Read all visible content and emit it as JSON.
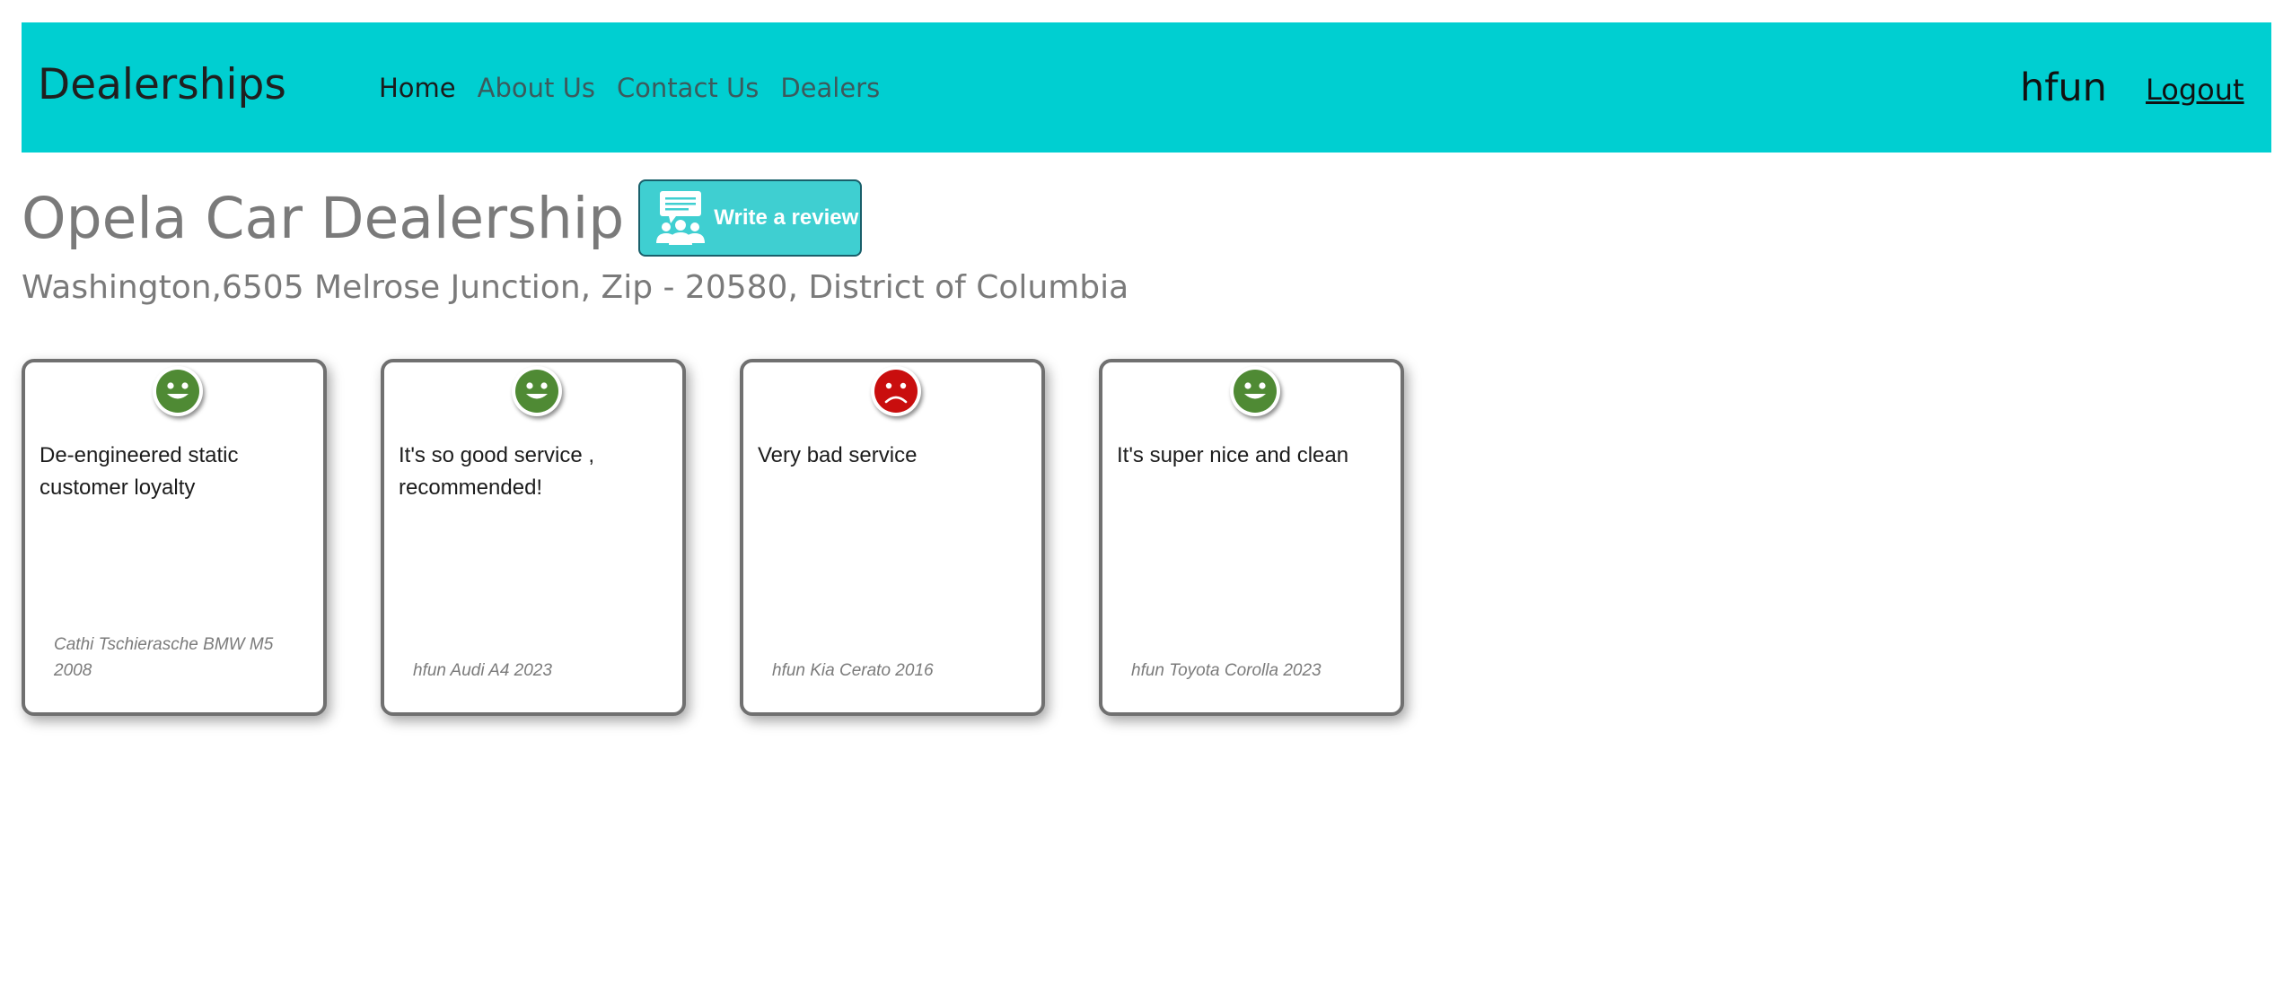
{
  "navbar": {
    "brand": "Dealerships",
    "links": [
      "Home",
      "About Us",
      "Contact Us",
      "Dealers"
    ],
    "active_link": "Home",
    "username": "hfun",
    "logout_label": "Logout",
    "background_color": "#00cfd1"
  },
  "dealer": {
    "name": "Opela Car Dealership",
    "address": "Washington,6505 Melrose Junction, Zip - 20580, District of Columbia",
    "write_review_label": "Write a review"
  },
  "reviews": [
    {
      "text": "De-engineered static customer loyalty",
      "reviewer": "Cathi Tschierasche BMW M5 2008",
      "sentiment": "positive",
      "icon": "smiley-positive-icon",
      "color": "#4f8a34"
    },
    {
      "text": "It's so good service , recommended!",
      "reviewer": "hfun Audi A4 2023",
      "sentiment": "positive",
      "icon": "smiley-positive-icon",
      "color": "#4f8a34"
    },
    {
      "text": "Very bad service",
      "reviewer": "hfun Kia Cerato 2016",
      "sentiment": "negative",
      "icon": "frown-negative-icon",
      "color": "#c90e0e"
    },
    {
      "text": "It's super nice and clean",
      "reviewer": "hfun Toyota Corolla 2023",
      "sentiment": "positive",
      "icon": "smiley-positive-icon",
      "color": "#4f8a34"
    }
  ]
}
